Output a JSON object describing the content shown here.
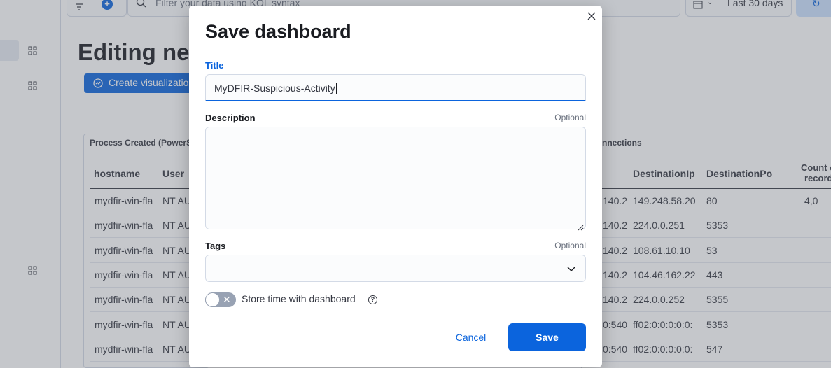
{
  "topbar": {
    "query_placeholder": "Filter your data using KQL syntax",
    "date_range": "Last 30 days",
    "refresh_label": "R"
  },
  "page": {
    "title": "Editing ne",
    "create_button": "Create visualizatio"
  },
  "left_panel": {
    "title": "Process Created (PowerS",
    "columns": [
      "hostname",
      "User"
    ],
    "rows": [
      [
        "mydfir-win-fla",
        "NT AU"
      ],
      [
        "mydfir-win-fla",
        "NT AU"
      ],
      [
        "mydfir-win-fla",
        "NT AU"
      ],
      [
        "mydfir-win-fla",
        "NT AU"
      ],
      [
        "mydfir-win-fla",
        "NT AU"
      ],
      [
        "mydfir-win-fla",
        "NT AU"
      ],
      [
        "mydfir-win-fla",
        "NT AU"
      ]
    ]
  },
  "right_panel": {
    "title": "nnections",
    "columns": [
      "DestinationIp",
      "DestinationPo",
      "Count of",
      "records"
    ],
    "rows": [
      [
        "140.2",
        "149.248.58.20",
        "80",
        "4,0"
      ],
      [
        "140.2",
        "224.0.0.251",
        "5353",
        ""
      ],
      [
        "140.2",
        "108.61.10.10",
        "53",
        ""
      ],
      [
        "140.2",
        "104.46.162.22",
        "443",
        ""
      ],
      [
        "140.2",
        "224.0.0.252",
        "5355",
        ""
      ],
      [
        "0:540",
        "ff02:0:0:0:0:0:",
        "5353",
        ""
      ],
      [
        "0:540",
        "ff02:0:0:0:0:0:",
        "547",
        ""
      ]
    ]
  },
  "modal": {
    "title": "Save dashboard",
    "title_label": "Title",
    "title_value": "MyDFIR-Suspicious-Activity",
    "description_label": "Description",
    "description_optional": "Optional",
    "tags_label": "Tags",
    "tags_optional": "Optional",
    "store_time_label": "Store time with dashboard",
    "cancel_label": "Cancel",
    "save_label": "Save"
  },
  "colors": {
    "primary": "#0b64dd",
    "overlay": "#5e646f",
    "text": "#1a1c21"
  }
}
